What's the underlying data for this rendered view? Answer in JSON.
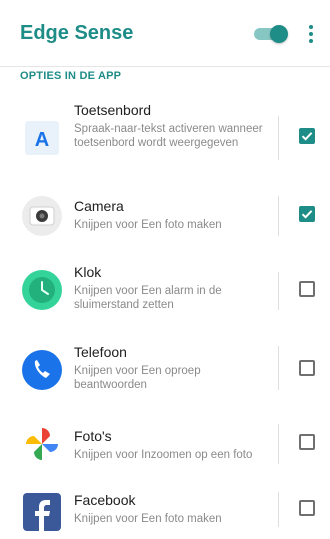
{
  "app": {
    "title": "Edge Sense",
    "enabled": true,
    "accent_color": "#1e8c87",
    "overflow_icon": "more-vert-icon"
  },
  "section": {
    "header": "OPTIES IN DE APP"
  },
  "items": [
    {
      "title": "Toetsenbord",
      "desc": "Spraak-naar-tekst activeren wanneer toetsenbord wordt weergegeven",
      "checked": true,
      "icon": "keyboard-icon"
    },
    {
      "title": "Camera",
      "desc": "Knijpen voor Een foto maken",
      "checked": true,
      "icon": "camera-icon"
    },
    {
      "title": "Klok",
      "desc": "Knijpen voor Een alarm in de sluimerstand zetten",
      "checked": false,
      "icon": "clock-icon"
    },
    {
      "title": "Telefoon",
      "desc": "Knijpen voor Een oproep beantwoorden",
      "checked": false,
      "icon": "phone-icon"
    },
    {
      "title": "Foto's",
      "desc": "Knijpen voor Inzoomen op een foto",
      "checked": false,
      "icon": "photos-icon"
    },
    {
      "title": "Facebook",
      "desc": "Knijpen voor Een foto maken",
      "checked": false,
      "icon": "facebook-icon"
    }
  ]
}
